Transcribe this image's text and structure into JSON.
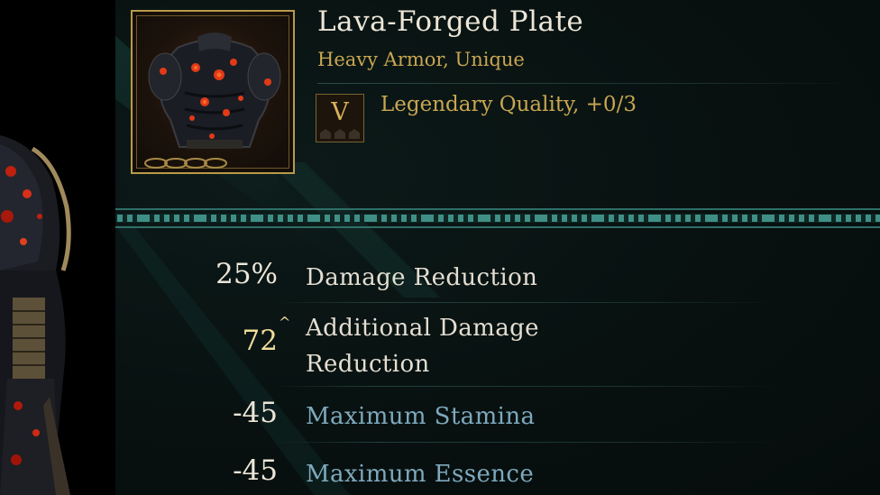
{
  "item": {
    "name": "Lava-Forged Plate",
    "type": "Heavy Armor, Unique",
    "icon": "lava-plate-armor-icon",
    "quality": {
      "letter": "V",
      "text": "Legendary Quality, +0/3",
      "pips_filled": 0,
      "pips_total": 3
    }
  },
  "stats": [
    {
      "value": "25%",
      "label": "Damage Reduction",
      "value_color": "white",
      "label_color": "white",
      "upgrade": false
    },
    {
      "value": "72",
      "label": "Additional Damage Reduction",
      "value_color": "gold",
      "label_color": "white",
      "upgrade": true,
      "upgrade_glyph": "^"
    },
    {
      "value": "-45",
      "label": "Maximum Stamina",
      "value_color": "white",
      "label_color": "blue",
      "upgrade": false
    },
    {
      "value": "-45",
      "label": "Maximum Essence",
      "value_color": "white",
      "label_color": "blue",
      "upgrade": false
    }
  ],
  "colors": {
    "gold": "#c9a652",
    "name": "#ece6d8",
    "stat_blue": "#7ea9bd",
    "divider_teal": "#3f8f86",
    "panel_bg": "#081110"
  }
}
